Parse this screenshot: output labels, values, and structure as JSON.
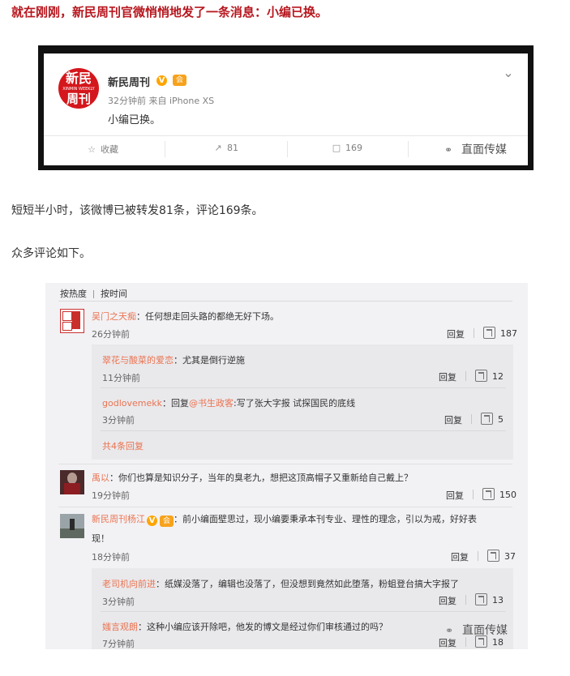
{
  "intro": {
    "headline": "就在刚刚，新民周刊官微悄悄地发了一条消息：小编已换。",
    "stats_line": "短短半小时，该微博已被转发81条，评论169条。",
    "comments_intro": "众多评论如下。"
  },
  "post": {
    "logo": {
      "line1": "新民",
      "line2": "XINMIN WEEKLY",
      "line3": "周刊"
    },
    "author": "新民周刊",
    "verified_badge": "V",
    "vip_badge": "会",
    "meta": "32分钟前 来自 iPhone XS",
    "text": "小编已换。",
    "actions": {
      "favorite_label": "收藏",
      "repost_count": "81",
      "comment_count": "169"
    }
  },
  "watermark": "直面传媒",
  "comments": {
    "tabs": {
      "hot": "按热度",
      "time": "按时间"
    },
    "reply_label": "回复",
    "items": [
      {
        "name": "吴门之天痴",
        "text": "：任何想走回头路的都绝无好下场。",
        "time": "26分钟前",
        "likes": "187",
        "replies": [
          {
            "name": "翠花与酸菜的爱恋",
            "text": "：尤其是倒行逆施",
            "time": "11分钟前",
            "likes": "12"
          },
          {
            "name": "godlovemekk",
            "prefix": "：回复",
            "mention": "@书生政客",
            "text": ":写了张大字报 试探国民的底线",
            "time": "3分钟前",
            "likes": "5"
          }
        ],
        "more": "共4条回复"
      },
      {
        "name": "禹以",
        "text": "：你们也算是知识分子，当年的臭老九，想把这顶高帽子又重新给自己戴上？",
        "time": "19分钟前",
        "likes": "150"
      },
      {
        "name": "新民周刊杨江",
        "text": "：前小编面壁思过，现小编要秉承本刊专业、理性的理念，引以为戒，好好表",
        "text2": "现！",
        "time": "18分钟前",
        "likes": "37",
        "replies": [
          {
            "name": "老司机向前进",
            "text": "：纸媒没落了，编辑也没落了，但没想到竟然如此堕落，粉蛆登台搞大字报了",
            "time": "3分钟前",
            "likes": "13"
          },
          {
            "name": "媸言观朗",
            "text": "：这种小编应该开除吧，他发的博文是经过你们审核通过的吗？",
            "time": "7分钟前",
            "likes": "18"
          }
        ]
      }
    ]
  },
  "colors": {
    "headline_red": "#b7171f",
    "name_orange": "#eb7350",
    "logo_red": "#d4171c"
  }
}
